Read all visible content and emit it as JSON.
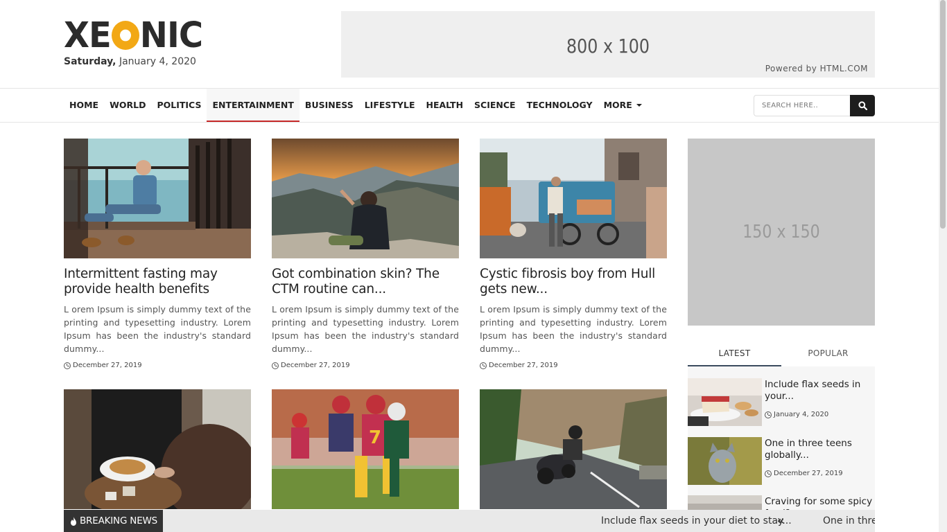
{
  "header": {
    "logo_text_left": "XE",
    "logo_text_right": "NIC",
    "date_day": "Saturday,",
    "date_rest": " January 4, 2020",
    "ad_size": "800 x 100",
    "ad_powered": "Powered by HTML.COM"
  },
  "nav": {
    "items": [
      "HOME",
      "WORLD",
      "POLITICS",
      "ENTERTAINMENT",
      "BUSINESS",
      "LIFESTYLE",
      "HEALTH",
      "SCIENCE",
      "TECHNOLOGY",
      "MORE"
    ],
    "active": "ENTERTAINMENT",
    "search_placeholder": "SEARCH HERE.."
  },
  "articles": [
    {
      "title": "Intermittent fasting may provide health benefits",
      "excerpt": "L orem Ipsum is simply dummy text of the printing and typesetting industry. Lorem Ipsum has been the industry's standard dummy...",
      "date": "December 27, 2019"
    },
    {
      "title": "Got combination skin? The CTM routine can...",
      "excerpt": "L orem Ipsum is simply dummy text of the printing and typesetting industry. Lorem Ipsum has been the industry's standard dummy...",
      "date": "December 27, 2019"
    },
    {
      "title": "Cystic fibrosis boy from Hull gets new...",
      "excerpt": "L orem Ipsum is simply dummy text of the printing and typesetting industry. Lorem Ipsum has been the industry's standard dummy...",
      "date": "December 27, 2019"
    }
  ],
  "sidebar": {
    "ad_size": "150 x 150",
    "tabs": [
      "LATEST",
      "POPULAR"
    ],
    "active_tab": "LATEST",
    "items": [
      {
        "title": "Include flax seeds in your...",
        "date": "January 4, 2020"
      },
      {
        "title": "One in three teens globally...",
        "date": "December 27, 2019"
      },
      {
        "title": "Craving for some spicy food?",
        "date": ""
      }
    ]
  },
  "breaking": {
    "label": "BREAKING NEWS",
    "items": [
      "Include flax seeds in your diet to stay...",
      "One in three teens globally..."
    ]
  }
}
